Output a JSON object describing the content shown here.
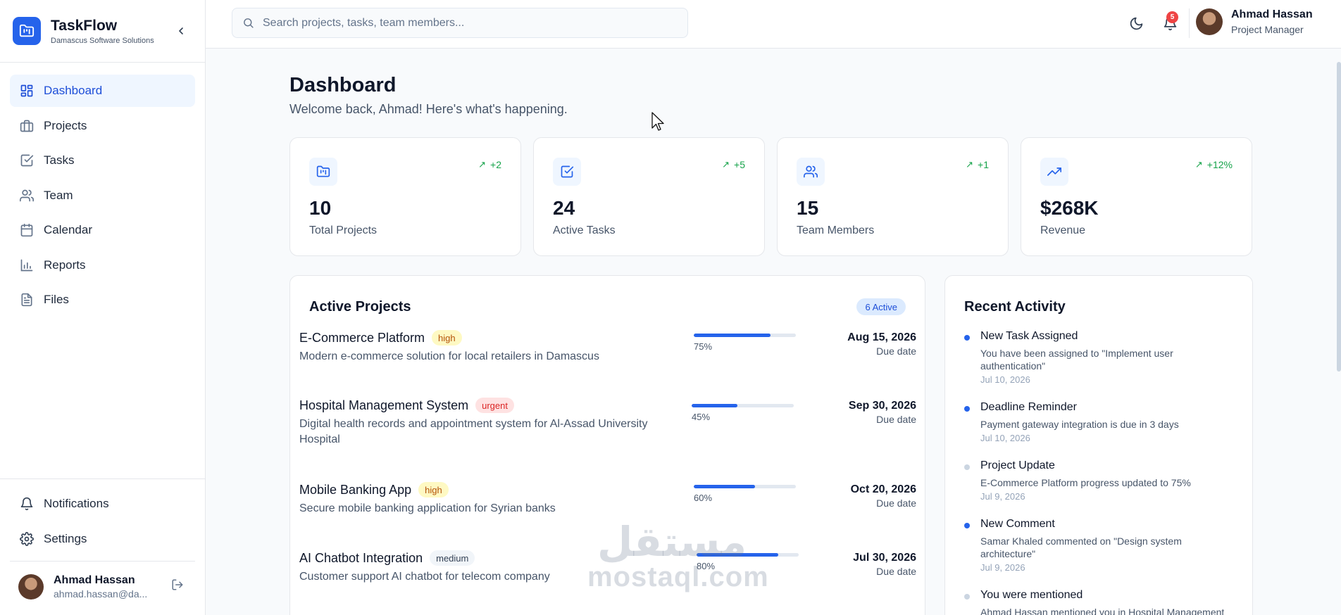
{
  "colors": {
    "accent": "#2563eb",
    "success": "#16a34a",
    "danger": "#ef4444"
  },
  "brand": {
    "title": "TaskFlow",
    "subtitle": "Damascus Software Solutions"
  },
  "sidebar": {
    "items": [
      {
        "label": "Dashboard",
        "icon": "layout-grid-icon",
        "active": true
      },
      {
        "label": "Projects",
        "icon": "briefcase-icon"
      },
      {
        "label": "Tasks",
        "icon": "check-square-icon"
      },
      {
        "label": "Team",
        "icon": "users-icon"
      },
      {
        "label": "Calendar",
        "icon": "calendar-icon"
      },
      {
        "label": "Reports",
        "icon": "bar-chart-icon"
      },
      {
        "label": "Files",
        "icon": "file-icon"
      }
    ],
    "bottom": [
      {
        "label": "Notifications",
        "icon": "bell-icon"
      },
      {
        "label": "Settings",
        "icon": "gear-icon"
      }
    ],
    "user": {
      "name": "Ahmad Hassan",
      "email": "ahmad.hassan@da..."
    }
  },
  "header": {
    "search_placeholder": "Search projects, tasks, team members...",
    "notification_count": "5",
    "user": {
      "name": "Ahmad Hassan",
      "role": "Project Manager"
    }
  },
  "page": {
    "title": "Dashboard",
    "subtitle": "Welcome back, Ahmad! Here's what's happening."
  },
  "stats": [
    {
      "value": "10",
      "label": "Total Projects",
      "change": "+2",
      "icon": "folder-kanban-icon"
    },
    {
      "value": "24",
      "label": "Active Tasks",
      "change": "+5",
      "icon": "check-square-icon"
    },
    {
      "value": "15",
      "label": "Team Members",
      "change": "+1",
      "icon": "users-icon"
    },
    {
      "value": "$268K",
      "label": "Revenue",
      "change": "+12%",
      "icon": "trending-up-icon"
    }
  ],
  "active_projects": {
    "title": "Active Projects",
    "badge": "6 Active",
    "items": [
      {
        "name": "E-Commerce Platform",
        "priority": "high",
        "description": "Modern e-commerce solution for local retailers in Damascus",
        "progress": 75,
        "progress_label": "75%",
        "due": "Aug 15, 2026",
        "due_label": "Due date"
      },
      {
        "name": "Hospital Management System",
        "priority": "urgent",
        "description": "Digital health records and appointment system for Al-Assad University Hospital",
        "progress": 45,
        "progress_label": "45%",
        "due": "Sep 30, 2026",
        "due_label": "Due date"
      },
      {
        "name": "Mobile Banking App",
        "priority": "high",
        "description": "Secure mobile banking application for Syrian banks",
        "progress": 60,
        "progress_label": "60%",
        "due": "Oct 20, 2026",
        "due_label": "Due date"
      },
      {
        "name": "AI Chatbot Integration",
        "priority": "medium",
        "description": "Customer support AI chatbot for telecom company",
        "progress": 80,
        "progress_label": "80%",
        "due": "Jul 30, 2026",
        "due_label": "Due date"
      }
    ]
  },
  "recent_activity": {
    "title": "Recent Activity",
    "items": [
      {
        "title": "New Task Assigned",
        "description": "You have been assigned to \"Implement user authentication\"",
        "time": "Jul 10, 2026",
        "unread": true
      },
      {
        "title": "Deadline Reminder",
        "description": "Payment gateway integration is due in 3 days",
        "time": "Jul 10, 2026",
        "unread": true
      },
      {
        "title": "Project Update",
        "description": "E-Commerce Platform progress updated to 75%",
        "time": "Jul 9, 2026",
        "unread": false
      },
      {
        "title": "New Comment",
        "description": "Samar Khaled commented on \"Design system architecture\"",
        "time": "Jul 9, 2026",
        "unread": true
      },
      {
        "title": "You were mentioned",
        "description": "Ahmad Hassan mentioned you in Hospital Management",
        "time": "",
        "unread": false
      }
    ]
  },
  "watermark": {
    "logo": "مستقل",
    "text": "mostaql.com"
  }
}
